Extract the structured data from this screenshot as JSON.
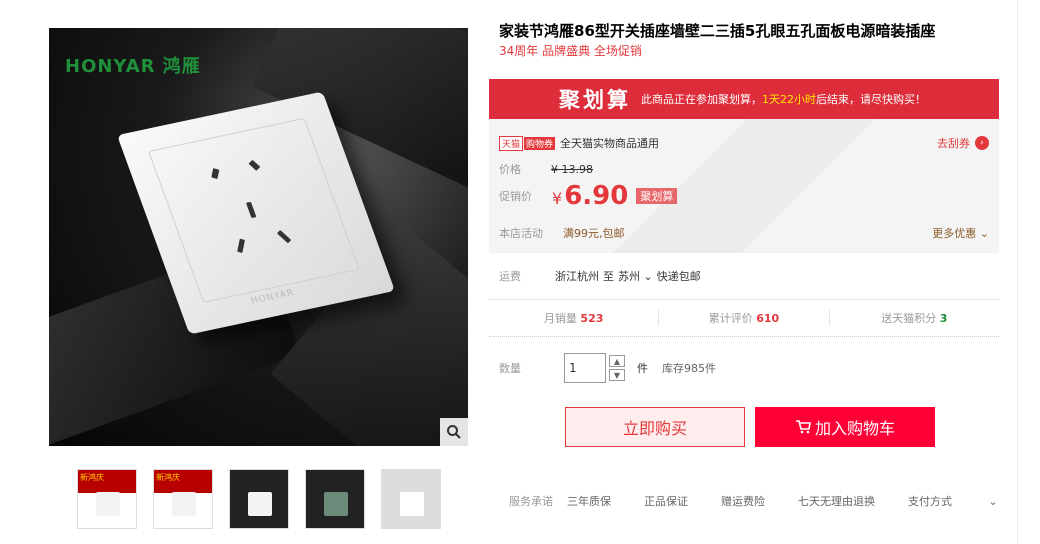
{
  "gallery": {
    "logo": "HONYAR 鸿雁",
    "plate_brand": "HONYAR",
    "thumb_tags": [
      "新鸿庆",
      "新鸿庆"
    ]
  },
  "product": {
    "title": "家装节鸿雁86型开关插座墙壁二三插5孔眼五孔面板电源暗装插座",
    "subtitle": "34周年 品牌盛典 全场促销"
  },
  "ju": {
    "label": "聚划算",
    "notice_pre": "此商品正在参加聚划算，",
    "notice_time": "1天22小时",
    "notice_post": "后结束，请尽快购买！"
  },
  "coupon": {
    "badge1": "天猫",
    "badge2": "购物券",
    "desc": "全天猫实物商品通用",
    "action": "去刮券"
  },
  "price": {
    "label": "价格",
    "original": "¥ 13.98",
    "promo_label": "促销价",
    "currency": "¥",
    "promo": "6.90",
    "promo_tag": "聚划算"
  },
  "shop_activity": {
    "label": "本店活动",
    "value": "满99元,包邮",
    "more": "更多优惠"
  },
  "shipping": {
    "label": "运费",
    "from": "浙江杭州",
    "to_word": "至",
    "to": "苏州",
    "method": "快递包邮"
  },
  "stats": {
    "monthly_label": "月销量",
    "monthly": "523",
    "reviews_label": "累计评价",
    "reviews": "610",
    "points_label": "送天猫积分",
    "points": "3"
  },
  "quantity": {
    "label": "数量",
    "value": "1",
    "unit": "件",
    "stock": "库存985件"
  },
  "buttons": {
    "buy": "立即购买",
    "cart": "加入购物车"
  },
  "service": {
    "label": "服务承诺",
    "items": [
      "三年质保",
      "正品保证",
      "赠运费险",
      "七天无理由退换",
      "支付方式"
    ]
  }
}
